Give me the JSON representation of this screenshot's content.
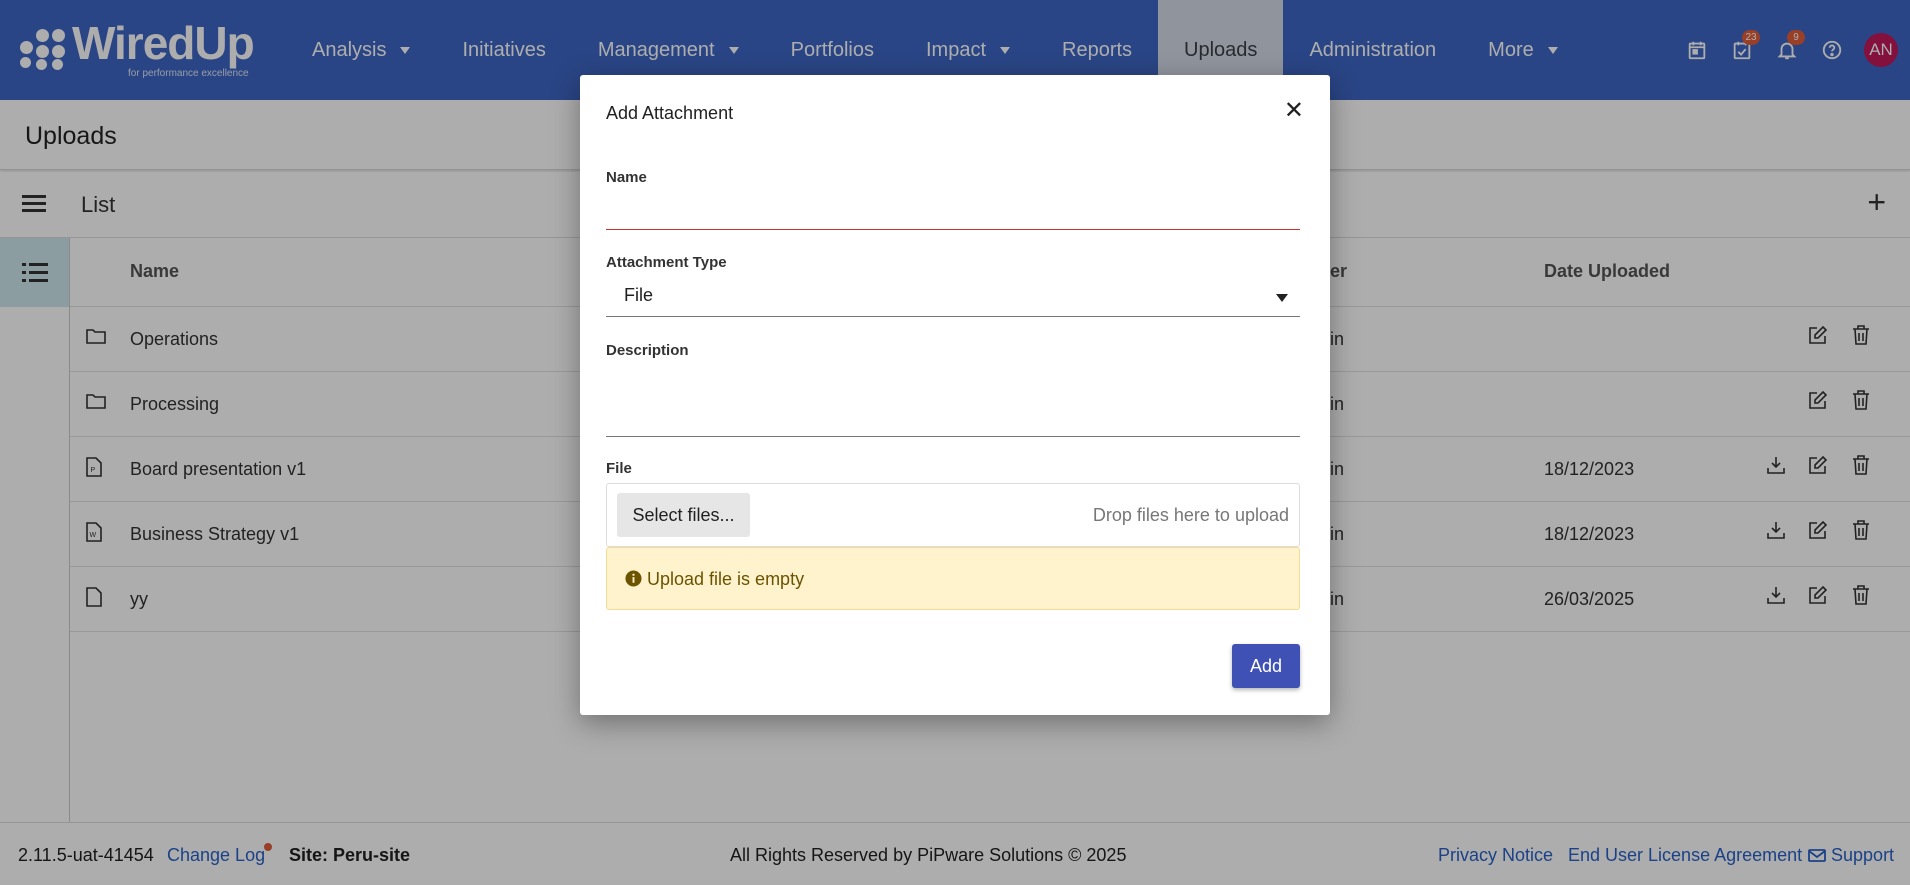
{
  "app": {
    "logo_text": "WiredUp",
    "logo_tagline": "for performance excellence"
  },
  "nav": {
    "items": [
      {
        "label": "Analysis",
        "dropdown": true
      },
      {
        "label": "Initiatives",
        "dropdown": false
      },
      {
        "label": "Management",
        "dropdown": true
      },
      {
        "label": "Portfolios",
        "dropdown": false
      },
      {
        "label": "Impact",
        "dropdown": true
      },
      {
        "label": "Reports",
        "dropdown": false
      },
      {
        "label": "Uploads",
        "dropdown": false,
        "active": true
      },
      {
        "label": "Administration",
        "dropdown": false
      },
      {
        "label": "More",
        "dropdown": true
      }
    ],
    "tasks_badge": "23",
    "notifications_badge": "9",
    "avatar_initials": "AN"
  },
  "page": {
    "title": "Uploads",
    "list_title": "List"
  },
  "table": {
    "headers": {
      "name": "Name",
      "owner": "er",
      "date": "Date Uploaded"
    },
    "rows": [
      {
        "icon": "folder-icon",
        "name": "Operations",
        "owner": "in",
        "date": "",
        "download": false
      },
      {
        "icon": "folder-icon",
        "name": "Processing",
        "owner": "in",
        "date": "",
        "download": false
      },
      {
        "icon": "pdf-file-icon",
        "name": "Board presentation v1",
        "owner": "in",
        "date": "18/12/2023",
        "download": true
      },
      {
        "icon": "word-file-icon",
        "name": "Business Strategy v1",
        "owner": "in",
        "date": "18/12/2023",
        "download": true
      },
      {
        "icon": "file-icon",
        "name": "yy",
        "owner": "in",
        "date": "26/03/2025",
        "download": true
      }
    ]
  },
  "footer": {
    "version": "2.11.5-uat-41454",
    "changelog": "Change Log",
    "site": "Site: Peru-site",
    "copyright": "All Rights Reserved by PiPware Solutions © 2025",
    "privacy": "Privacy Notice",
    "eula": "End User License Agreement",
    "support": "Support"
  },
  "modal": {
    "title": "Add Attachment",
    "name_label": "Name",
    "name_value": "",
    "type_label": "Attachment Type",
    "type_value": "File",
    "description_label": "Description",
    "description_value": "",
    "file_label": "File",
    "select_files": "Select files...",
    "drop_hint": "Drop files here to upload",
    "warning": "Upload file is empty",
    "add_button": "Add"
  },
  "colors": {
    "nav": "#3f66c4",
    "accent": "#3f51b5",
    "badge": "#e35d3a",
    "warning_bg": "#fff3cd"
  }
}
